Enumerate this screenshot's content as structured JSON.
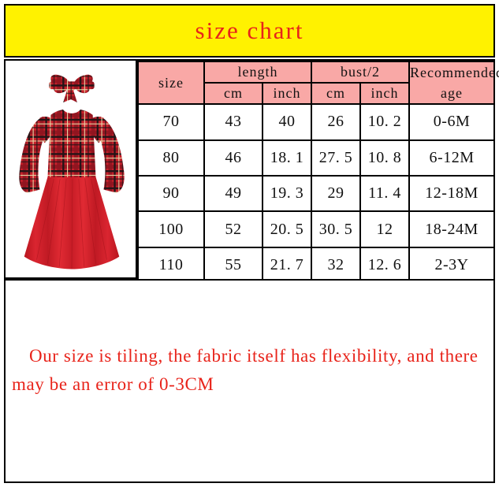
{
  "title": "size chart",
  "table": {
    "headers": {
      "size": "size",
      "length": "length",
      "bust": "bust/2",
      "recommended_age": "Recommended age",
      "length_cm": "cm",
      "length_inch": "inch",
      "bust_cm": "cm",
      "bust_inch": "inch"
    },
    "rows": [
      {
        "size": "70",
        "length_cm": "43",
        "length_inch": "40",
        "bust_cm": "26",
        "bust_inch": "10. 2",
        "age": "0-6M"
      },
      {
        "size": "80",
        "length_cm": "46",
        "length_inch": "18. 1",
        "bust_cm": "27. 5",
        "bust_inch": "10. 8",
        "age": "6-12M"
      },
      {
        "size": "90",
        "length_cm": "49",
        "length_inch": "19. 3",
        "bust_cm": "29",
        "bust_inch": "11. 4",
        "age": "12-18M"
      },
      {
        "size": "100",
        "length_cm": "52",
        "length_inch": "20. 5",
        "bust_cm": "30. 5",
        "bust_inch": "12",
        "age": "18-24M"
      },
      {
        "size": "110",
        "length_cm": "55",
        "length_inch": "21. 7",
        "bust_cm": "32",
        "bust_inch": "12. 6",
        "age": "2-3Y"
      }
    ]
  },
  "note": "Our size is tiling, the fabric itself has flexibility, and there may be an error of 0-3CM",
  "product_image": {
    "description": "red tartan plaid girls dress with matching bow headband"
  },
  "colors": {
    "banner_background": "#FFF200",
    "title_text": "#E8231A",
    "header_cell": "#F9A8A6",
    "size_cell": "#CBF2CC",
    "note_text": "#E8231A",
    "border": "#000000",
    "plaid_red": "#C8202B",
    "plaid_dark": "#2A1A1E",
    "plaid_cream": "#E8D9A8",
    "skirt_red": "#D6202A"
  }
}
